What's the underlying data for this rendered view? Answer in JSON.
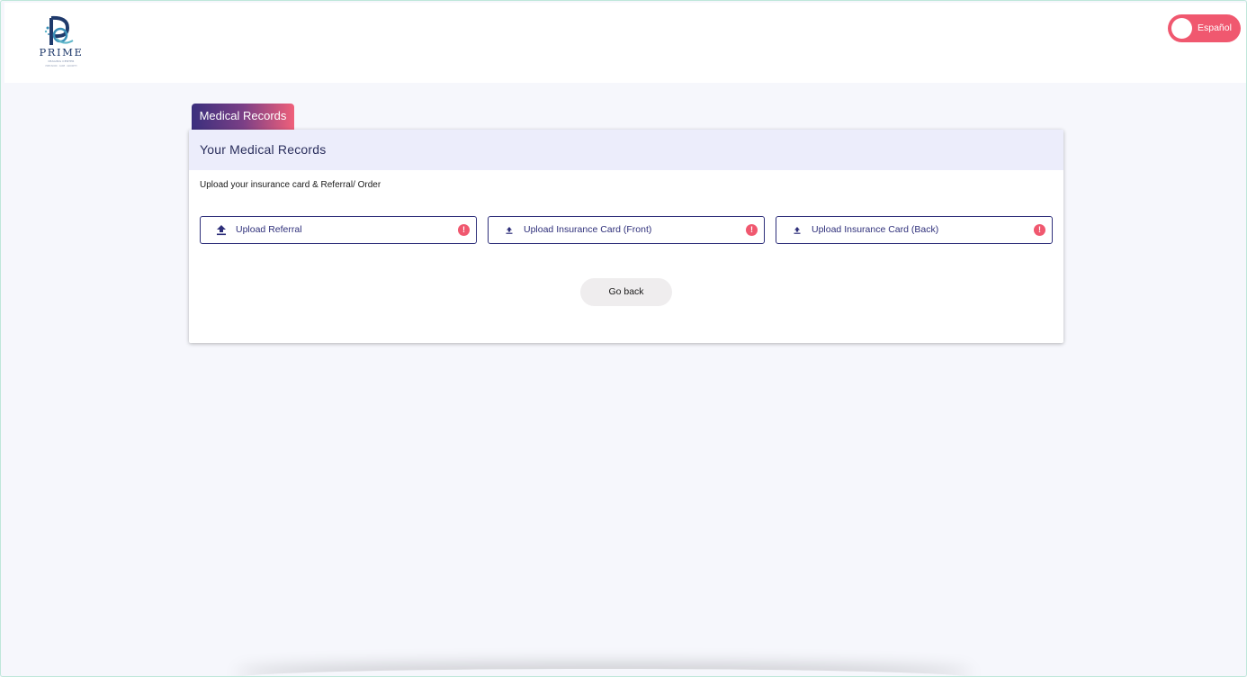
{
  "header": {
    "logo": {
      "icon": "prime-logo-icon",
      "wordmark": "PRIME",
      "tagline": "IMAGING CENTER",
      "subtagline": "PRECISION · CARE · GROWTH"
    },
    "language_toggle": {
      "label": "Español",
      "state": "off"
    }
  },
  "tab": {
    "label": "Medical Records"
  },
  "card": {
    "title": "Your Medical Records",
    "instructions": "Upload your insurance card & Referral/ Order",
    "uploads": [
      {
        "label": "Upload Referral",
        "icon": "upload-icon",
        "status_icon": "alert-icon",
        "status_mark": "!"
      },
      {
        "label": "Upload Insurance Card (Front)",
        "icon": "upload-icon",
        "status_icon": "alert-icon",
        "status_mark": "!"
      },
      {
        "label": "Upload Insurance Card (Back)",
        "icon": "upload-icon",
        "status_icon": "alert-icon",
        "status_mark": "!"
      }
    ],
    "go_back_label": "Go back"
  },
  "colors": {
    "accent_pink": "#f0586f",
    "primary_navy": "#2e2f7a",
    "card_header_bg": "#ecedfb",
    "page_bg": "#f6f7fc",
    "tab_gradient_start": "#3a2f7d",
    "tab_gradient_end": "#f0607a"
  }
}
